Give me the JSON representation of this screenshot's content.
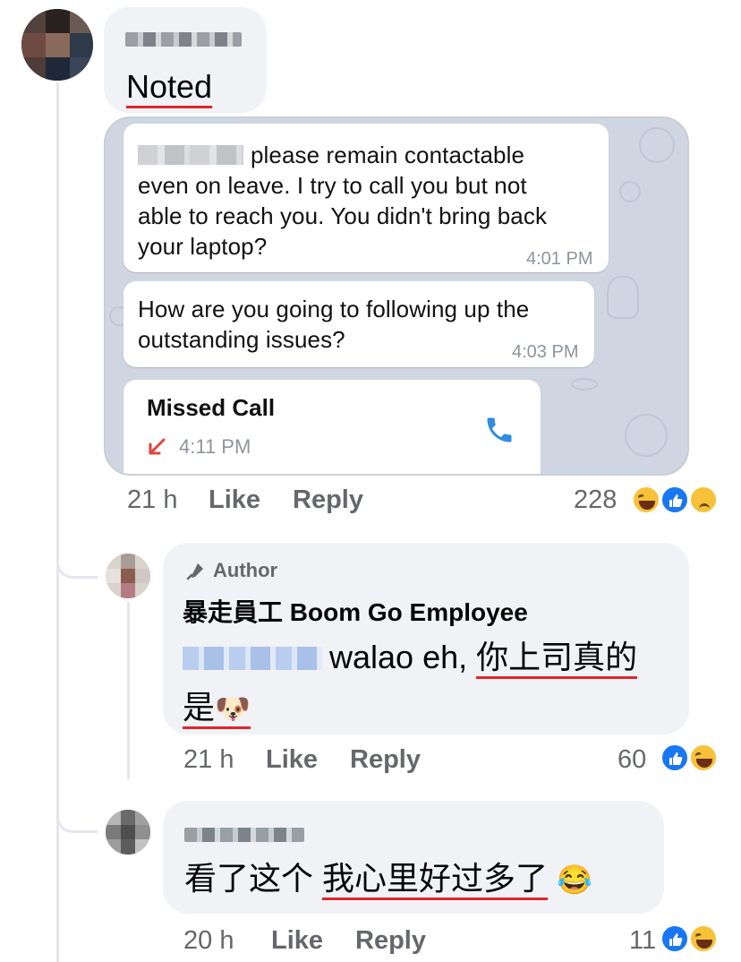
{
  "comments": [
    {
      "text": "Noted",
      "time": "21 h",
      "like_label": "Like",
      "reply_label": "Reply",
      "reaction_count": "228",
      "reactions": [
        "haha-icon",
        "like-icon",
        "sad-icon"
      ]
    },
    {
      "author_badge": "Author",
      "author_name": "暴走員工 Boom Go Employee",
      "text_prefix": "walao eh, ",
      "text_highlight_1": "你上司真的",
      "text_highlight_2": "是",
      "text_emoji": "🐶",
      "time": "21 h",
      "like_label": "Like",
      "reply_label": "Reply",
      "reaction_count": "60",
      "reactions": [
        "like-icon",
        "haha-icon"
      ]
    },
    {
      "text_prefix": "看了这个 ",
      "text_highlight": "我心里好过多了",
      "text_emoji": "😂",
      "time": "20 h",
      "like_label": "Like",
      "reply_label": "Reply",
      "reaction_count": "11",
      "reactions": [
        "like-icon",
        "haha-icon"
      ]
    }
  ],
  "telegram": {
    "messages": [
      {
        "line1": "please remain contactable",
        "line2": "even on leave. I try to call you but not",
        "line3": "able to reach you. You didn't bring back",
        "line4": "your laptop?",
        "time": "4:01 PM"
      },
      {
        "line1": "How are you going to following up the",
        "line2": "outstanding issues?",
        "time": "4:03 PM"
      }
    ],
    "missed_call": {
      "title": "Missed Call",
      "time": "4:11 PM"
    }
  },
  "colors": {
    "underline": "#e0262b",
    "bubble": "#f0f2f5",
    "meta": "#65676b",
    "call_blue": "#2f8ce0"
  }
}
